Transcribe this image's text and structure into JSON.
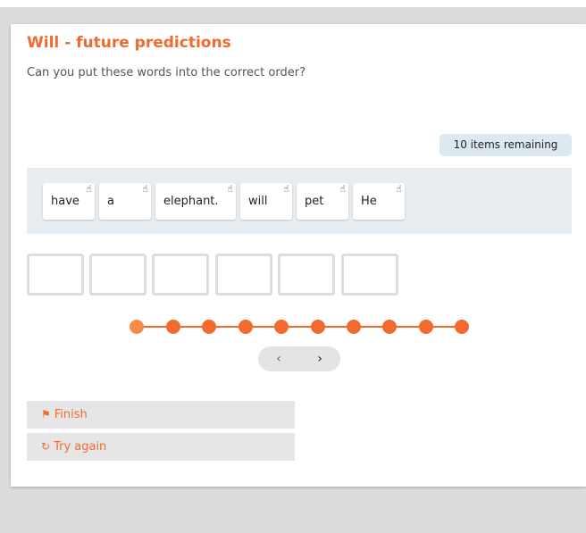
{
  "activity": {
    "title": "Will - future predictions",
    "instruction": "Can you put these words into the correct order?",
    "remaining_label": "10 items remaining"
  },
  "word_pool": [
    {
      "text": "have"
    },
    {
      "text": "a"
    },
    {
      "text": "elephant."
    },
    {
      "text": "will"
    },
    {
      "text": "pet"
    },
    {
      "text": "He"
    }
  ],
  "answer_slots": 6,
  "progress": {
    "total_items": 10,
    "current_index": 0
  },
  "navigation": {
    "prev_glyph": "‹",
    "next_glyph": "›"
  },
  "actions": {
    "finish_label": "Finish",
    "finish_icon": "flag-icon",
    "try_again_label": "Try again",
    "try_again_icon": "refresh-icon"
  },
  "colors": {
    "accent": "#f26a2e",
    "accent_current": "#f58c49",
    "badge_bg": "#dde9f0",
    "pool_bg": "#e8edf1"
  }
}
